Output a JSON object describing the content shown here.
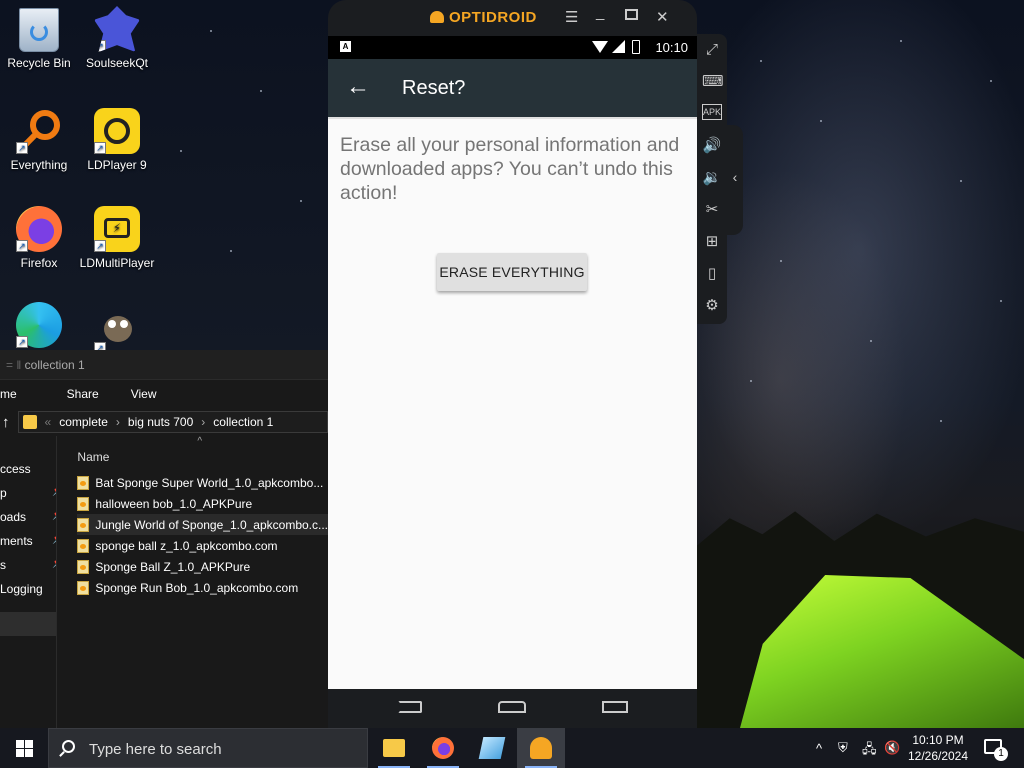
{
  "desktop": {
    "icons": [
      {
        "label": "Recycle Bin",
        "icon": "recycle-bin-icon"
      },
      {
        "label": "SoulseekQt",
        "icon": "soulseek-icon"
      },
      {
        "label": "Everything",
        "icon": "everything-search-icon"
      },
      {
        "label": "LDPlayer 9",
        "icon": "ldplayer-icon"
      },
      {
        "label": "Firefox",
        "icon": "firefox-icon"
      },
      {
        "label": "LDMultiPlayer",
        "icon": "ldmultiplayer-icon"
      },
      {
        "label": "",
        "icon": "edge-icon"
      },
      {
        "label": "",
        "icon": "gimp-icon"
      }
    ]
  },
  "explorer": {
    "title": "collection 1",
    "menu": [
      "me",
      "Share",
      "View"
    ],
    "breadcrumb": [
      "complete",
      "big nuts 700",
      "collection 1"
    ],
    "column_header": "Name",
    "nav_items": [
      "ccess",
      "p",
      "oads",
      "ments",
      "s",
      "Logging"
    ],
    "files": [
      "Bat Sponge Super World_1.0_apkcombo...",
      "halloween bob_1.0_APKPure",
      "Jungle World of Sponge_1.0_apkcombo.c...",
      "sponge ball z_1.0_apkcombo.com",
      "Sponge Ball Z_1.0_APKPure",
      "Sponge Run Bob_1.0_apkcombo.com"
    ],
    "highlighted_file_index": 2
  },
  "emulator": {
    "brand": "OPTIDROID",
    "status_time": "10:10",
    "app_bar_title": "Reset?",
    "message": "Erase all your personal information and downloaded apps? You can’t undo this action!",
    "button_label": "ERASE EVERYTHING",
    "sidebar_tools": [
      "fullscreen-icon",
      "keyboard-icon",
      "apk-install-icon",
      "volume-up-icon",
      "volume-down-icon",
      "screenshot-scissors-icon",
      "add-window-icon",
      "shake-icon",
      "settings-gear-icon"
    ]
  },
  "taskbar": {
    "search_placeholder": "Type here to search",
    "clock_time": "10:10 PM",
    "clock_date": "12/26/2024",
    "notification_count": "1"
  },
  "colors": {
    "app_bar": "#263238",
    "emulator_frame": "#1b1d20",
    "brand_orange": "#f5a623",
    "taskbar": "#16181f"
  }
}
